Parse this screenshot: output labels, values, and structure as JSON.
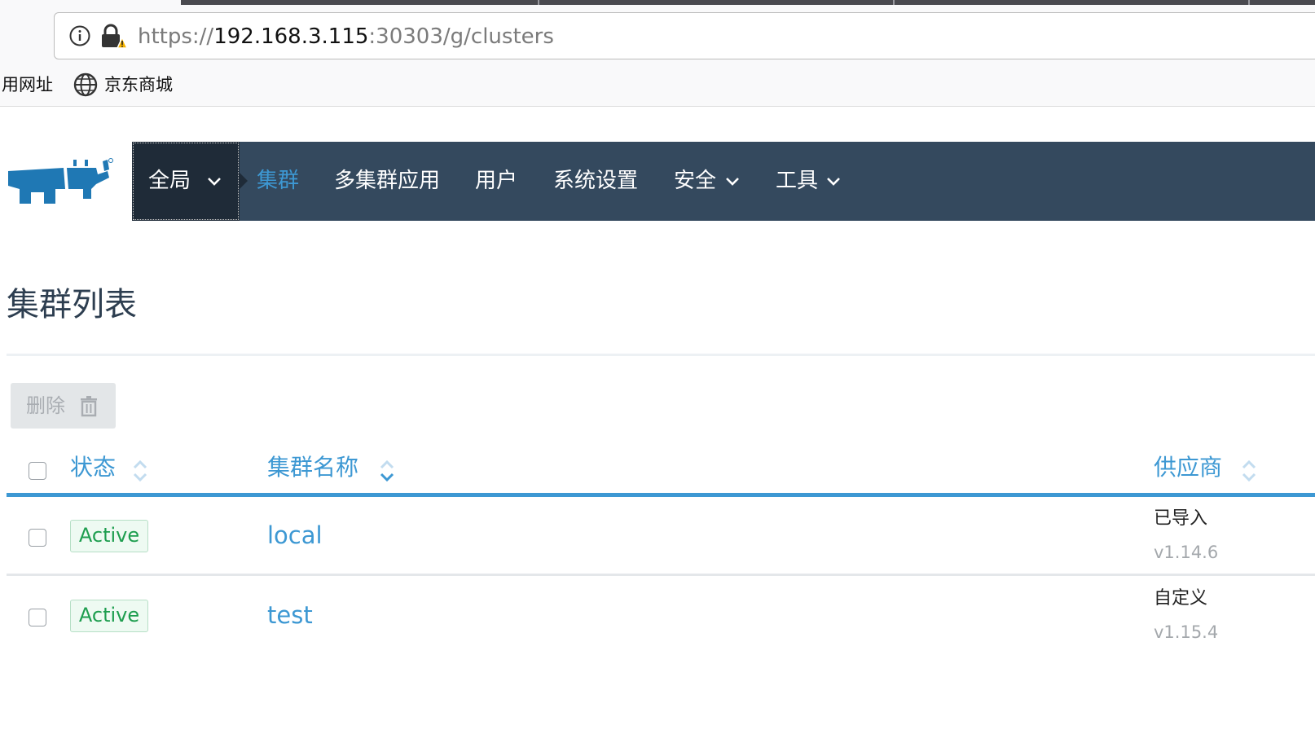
{
  "browser": {
    "url_prefix": "https://",
    "url_host": "192.168.3.115",
    "url_rest": ":30303/g/clusters",
    "bookmarks": [
      {
        "label": "用网址"
      },
      {
        "label": "京东商城",
        "icon": "globe-icon"
      }
    ]
  },
  "nav": {
    "global_label": "全局",
    "items": [
      {
        "label": "集群",
        "active": true
      },
      {
        "label": "多集群应用"
      },
      {
        "label": "用户"
      },
      {
        "label": "系统设置"
      },
      {
        "label": "安全",
        "dropdown": true
      },
      {
        "label": "工具",
        "dropdown": true
      }
    ]
  },
  "page": {
    "title": "集群列表",
    "delete_label": "删除"
  },
  "table": {
    "columns": [
      "状态",
      "集群名称",
      "供应商"
    ],
    "rows": [
      {
        "status": "Active",
        "name": "local",
        "provider": "已导入",
        "version": "v1.14.6"
      },
      {
        "status": "Active",
        "name": "test",
        "provider": "自定义",
        "version": "v1.15.4"
      }
    ]
  },
  "colors": {
    "nav_bg": "#34495e",
    "nav_global_bg": "#1f2b38",
    "accent": "#3d98d3",
    "active_status": "#1e9e4f",
    "logo": "#1f78b4"
  }
}
